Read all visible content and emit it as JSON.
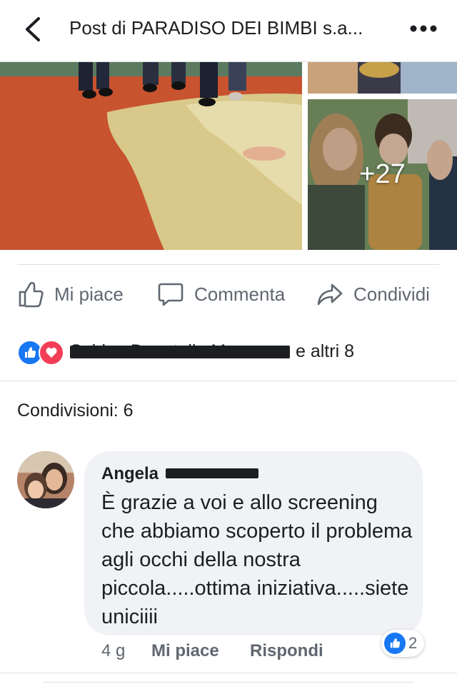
{
  "header": {
    "title": "Post di PARADISO DEI BIMBI s.a...",
    "back_icon": "chevron-left-icon",
    "more_icon": "more-horizontal-icon"
  },
  "photos": {
    "more_count": "+27"
  },
  "actions": {
    "like_label": "Mi piace",
    "comment_label": "Commenta",
    "share_label": "Condividi"
  },
  "reactions": {
    "names": "Sabina Donatella Marra",
    "others": "e altri 8"
  },
  "shares": {
    "label": "Condivisioni: 6"
  },
  "comment": {
    "author": "Angela",
    "text": "È grazie a voi e allo screening che abbiamo scoperto il problema agli occhi della nostra piccola.....ottima iniziativa.....siete uniciiii",
    "time": "4 g",
    "like_label": "Mi piace",
    "reply_label": "Rispondi",
    "reaction_count": "2"
  },
  "colors": {
    "accent": "#1877f2",
    "love": "#f33e58",
    "secondary_text": "#606770"
  }
}
